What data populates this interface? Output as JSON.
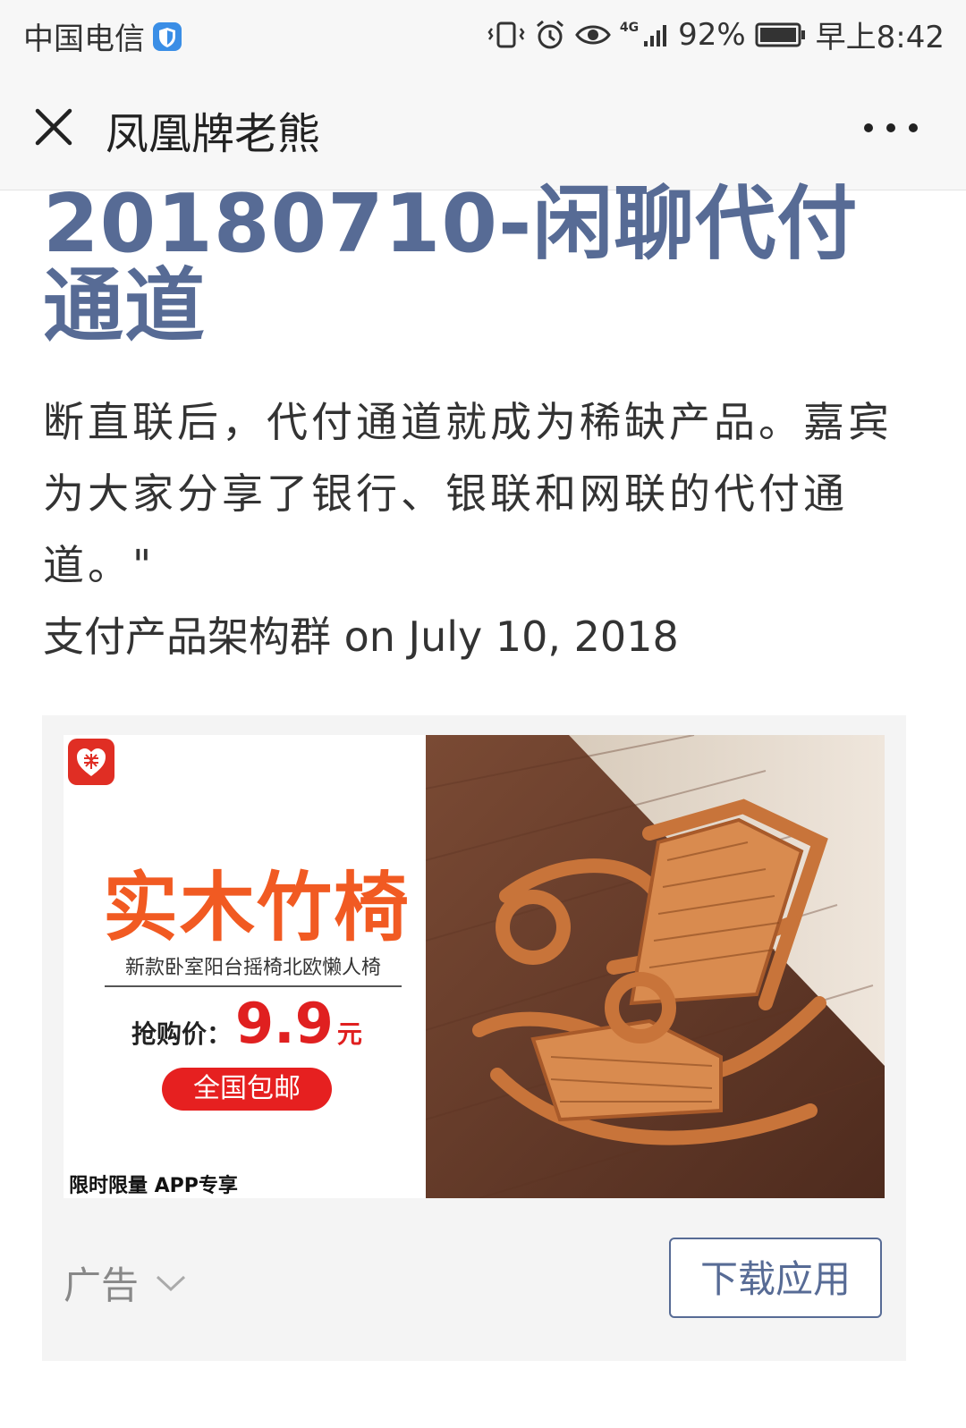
{
  "status_bar": {
    "carrier": "中国电信",
    "battery": "92%",
    "time": "早上8:42",
    "network": "4G",
    "icons": [
      "shield-icon",
      "vibrate-icon",
      "alarm-icon",
      "eye-icon",
      "signal-icon",
      "battery-icon"
    ]
  },
  "nav": {
    "title": "凤凰牌老熊",
    "close_icon": "close-icon",
    "more_icon": "more-icon"
  },
  "article": {
    "title": "20180710-闲聊代付通道",
    "description": "断直联后，代付通道就成为稀缺产品。嘉宾为大家分享了银行、银联和网联的代付通道。\"",
    "meta": "支付产品架构群 on July 10, 2018"
  },
  "ad": {
    "headline": "实木竹椅",
    "subheadline": "新款卧室阳台摇椅北欧懒人椅",
    "price_label": "抢购价：",
    "price": "9.9",
    "price_unit": "元",
    "shipping": "全国包邮",
    "footnote": "限时限量 APP专享",
    "label": "广告",
    "button": "下载应用",
    "colors": {
      "brand": "#e02e24",
      "headline": "#f15a22",
      "price": "#e02020",
      "link": "#576b95"
    }
  }
}
